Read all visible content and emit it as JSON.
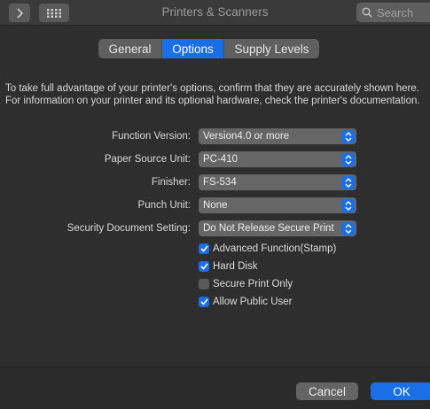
{
  "window": {
    "title": "Printers & Scanners",
    "search_placeholder": "Search"
  },
  "tabs": [
    {
      "label": "General",
      "active": false
    },
    {
      "label": "Options",
      "active": true
    },
    {
      "label": "Supply Levels",
      "active": false
    }
  ],
  "intro_text": "To take full advantage of your printer's options, confirm that they are accurately shown here. For information on your printer and its optional hardware, check the printer's documentation.",
  "options": [
    {
      "label": "Function Version:",
      "value": "Version4.0 or more"
    },
    {
      "label": "Paper Source Unit:",
      "value": "PC-410"
    },
    {
      "label": "Finisher:",
      "value": "FS-534"
    },
    {
      "label": "Punch Unit:",
      "value": "None"
    },
    {
      "label": "Security Document Setting:",
      "value": "Do Not Release Secure Print"
    }
  ],
  "checkboxes": [
    {
      "label": "Advanced Function(Stamp)",
      "checked": true
    },
    {
      "label": "Hard Disk",
      "checked": true
    },
    {
      "label": "Secure Print Only",
      "checked": false
    },
    {
      "label": "Allow Public User",
      "checked": true
    }
  ],
  "buttons": {
    "cancel": "Cancel",
    "ok": "OK"
  },
  "colors": {
    "accent": "#1a6ee6",
    "background": "#323232"
  }
}
